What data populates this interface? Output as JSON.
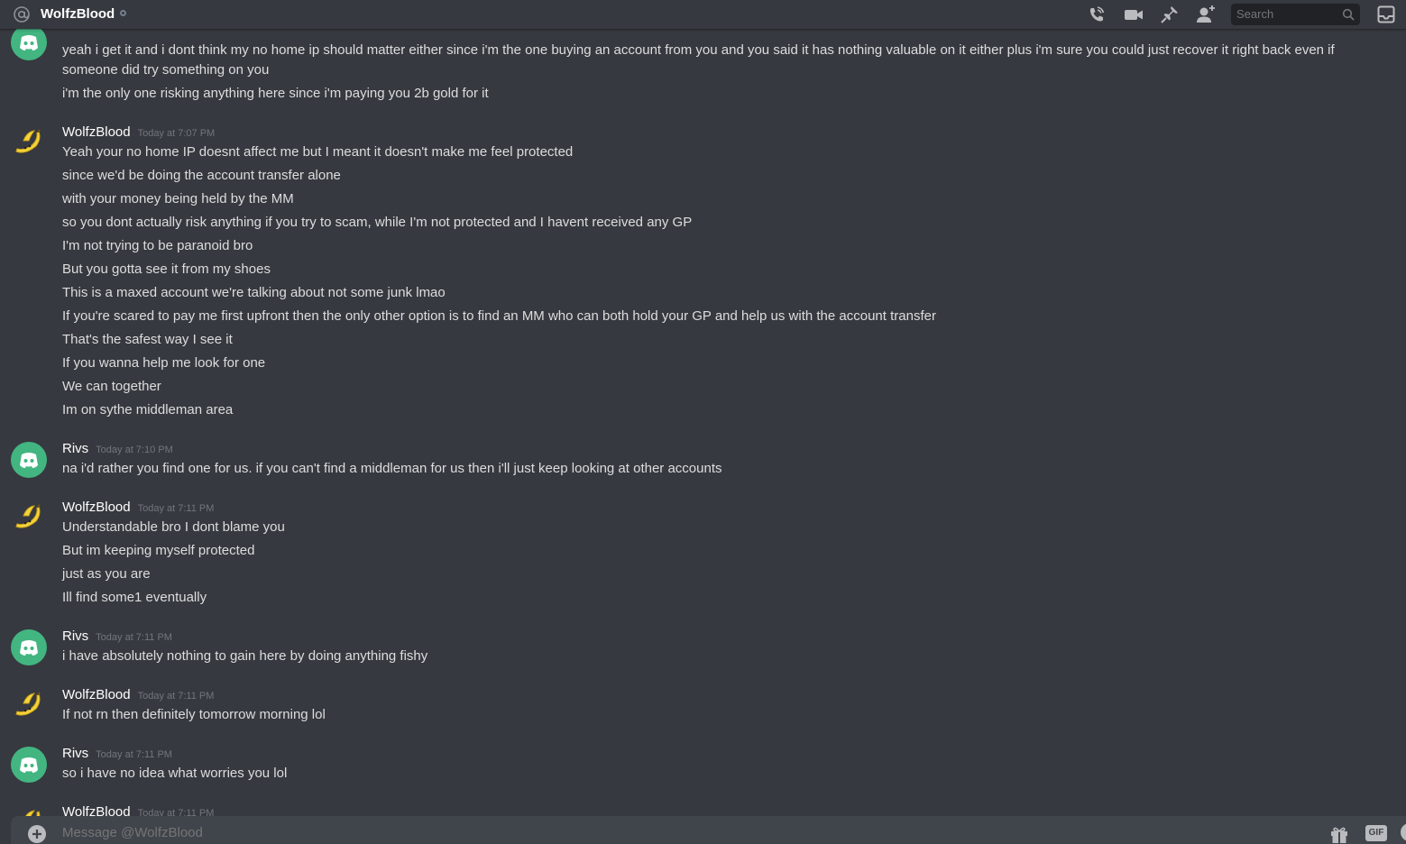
{
  "header": {
    "channel_name": "WolfzBlood",
    "search_placeholder": "Search",
    "icons": [
      "at-icon",
      "call-icon",
      "video-icon",
      "pin-icon",
      "add-friend-icon",
      "search-icon",
      "inbox-icon"
    ]
  },
  "colors": {
    "background": "#36393f",
    "discord_avatar": "#43b581",
    "author": "#ffffff",
    "timestamp": "#72767d",
    "text": "#dcddde"
  },
  "messages": [
    {
      "avatar": "discord",
      "lines": [
        "yeah i get it and i dont think my no home ip should matter either since i'm the one buying an account from you and you said it has nothing valuable on it either plus i'm sure you could just recover it right back even if someone did try something on you",
        "i'm the only one risking anything here since i'm paying you 2b gold for it"
      ]
    },
    {
      "author": "WolfzBlood",
      "timestamp": "Today at 7:07 PM",
      "avatar": "banana",
      "lines": [
        "Yeah your no home IP doesnt affect me but I meant it doesn't make me feel protected",
        "since we'd be doing the account transfer alone",
        "with your money being held by the MM",
        "so you dont actually risk anything if you try to scam, while I'm not protected and I havent received any GP",
        "I'm not trying to be paranoid bro",
        "But you gotta see it from my shoes",
        "This is a maxed account we're talking about not some junk lmao",
        "If you're scared to pay me first upfront then the only other option is to find an MM who can both hold your GP and help us with the account transfer",
        "That's the safest way I see it",
        "If you wanna help me look for one",
        "We can together",
        "Im on sythe middleman area"
      ]
    },
    {
      "author": "Rivs",
      "timestamp": "Today at 7:10 PM",
      "avatar": "discord",
      "lines": [
        "na i'd rather you find one for us. if you can't find a middleman for us then i'll just keep looking at other accounts"
      ]
    },
    {
      "author": "WolfzBlood",
      "timestamp": "Today at 7:11 PM",
      "avatar": "banana",
      "lines": [
        "Understandable bro I dont blame you",
        "But im keeping myself protected",
        "just as you are",
        "Ill find some1 eventually"
      ]
    },
    {
      "author": "Rivs",
      "timestamp": "Today at 7:11 PM",
      "avatar": "discord",
      "lines": [
        "i have absolutely nothing to gain here by doing anything fishy"
      ]
    },
    {
      "author": "WolfzBlood",
      "timestamp": "Today at 7:11 PM",
      "avatar": "banana",
      "lines": [
        "If not rn then definitely tomorrow morning lol"
      ]
    },
    {
      "author": "Rivs",
      "timestamp": "Today at 7:11 PM",
      "avatar": "discord",
      "lines": [
        "so i have no idea what worries you lol"
      ]
    },
    {
      "author": "WolfzBlood",
      "timestamp": "Today at 7:11 PM",
      "avatar": "banana",
      "lines": []
    }
  ],
  "composer": {
    "placeholder": "Message @WolfzBlood",
    "gif_label": "GIF"
  }
}
